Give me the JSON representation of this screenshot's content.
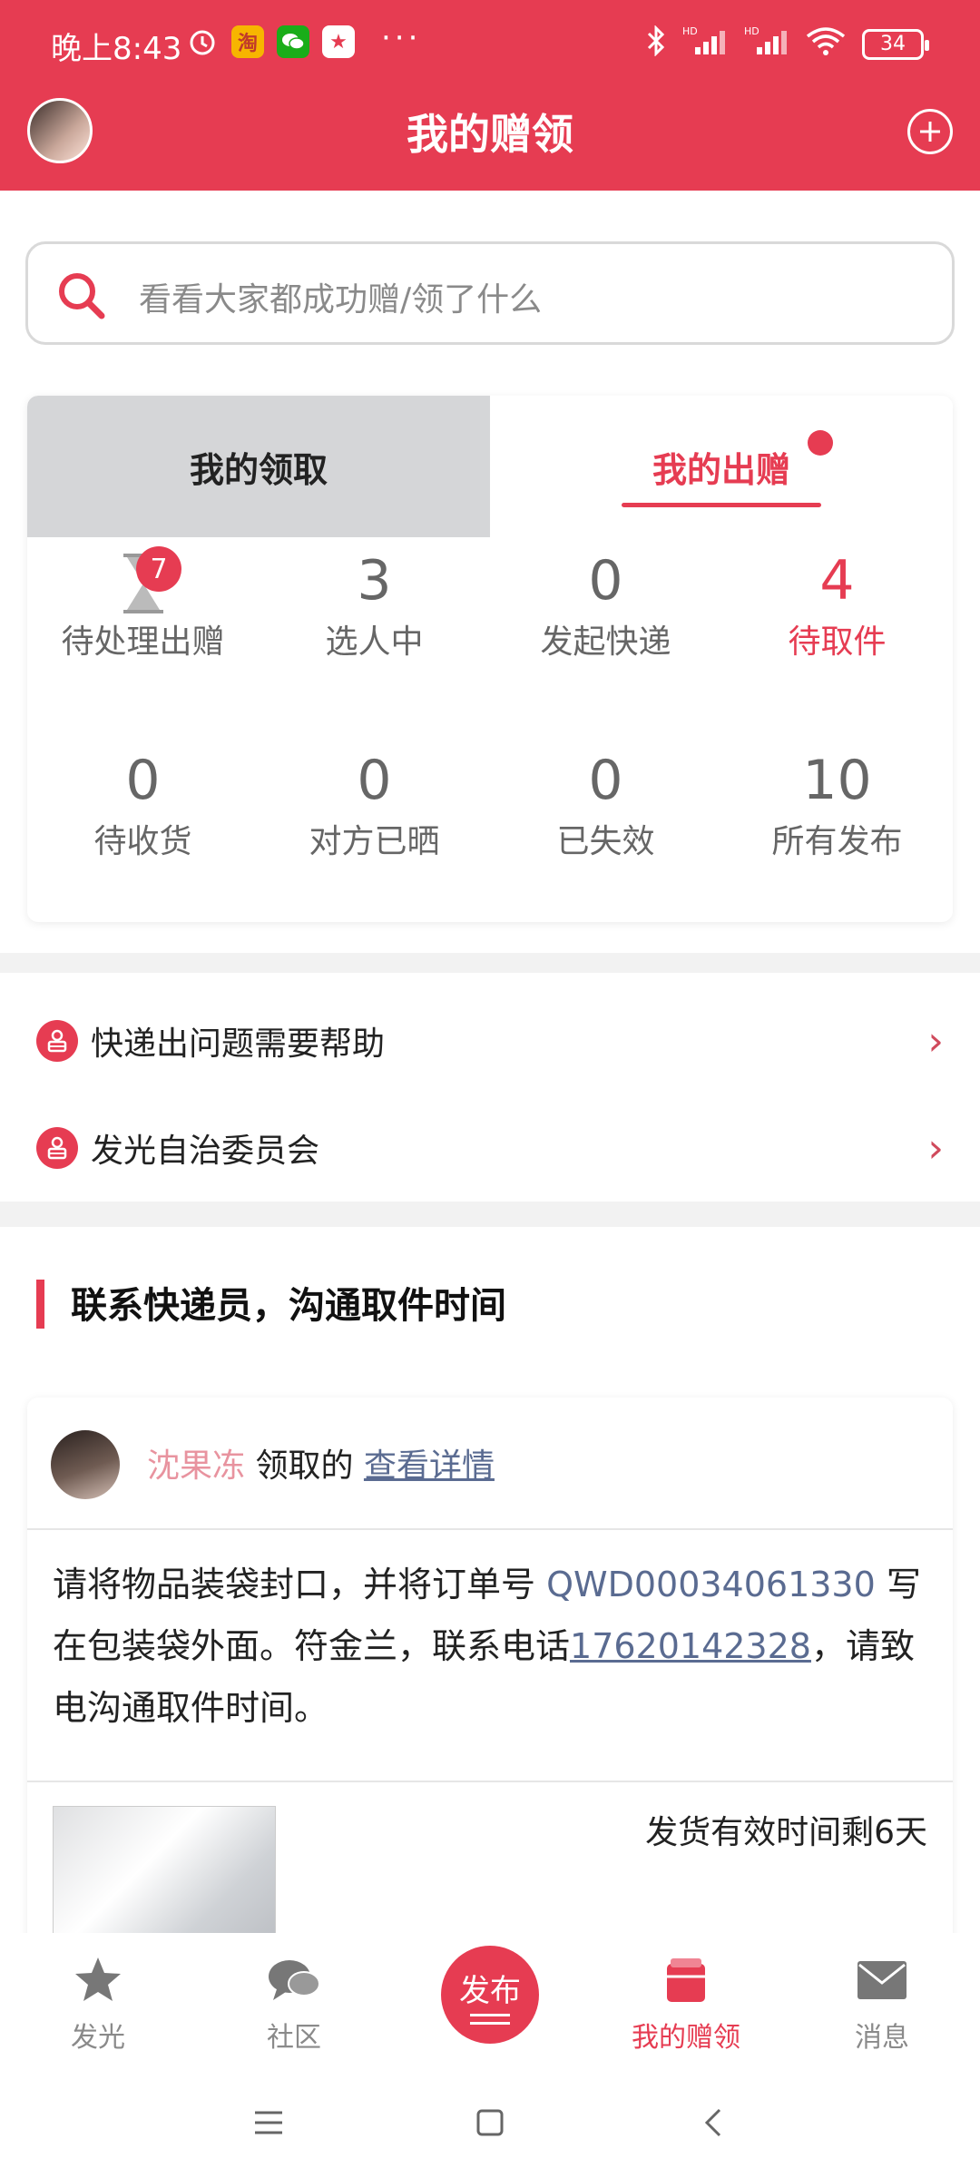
{
  "status_bar": {
    "time": "晚上8:43",
    "dots": "···",
    "battery": "34"
  },
  "header": {
    "title": "我的赠领"
  },
  "search": {
    "placeholder": "看看大家都成功赠/领了什么"
  },
  "tabs": [
    {
      "label": "我的领取",
      "active": false
    },
    {
      "label": "我的出赠",
      "active": true,
      "has_dot": true
    }
  ],
  "stats": [
    {
      "value": "",
      "label": "待处理出赠",
      "badge": "7",
      "icon": "hourglass-icon"
    },
    {
      "value": "3",
      "label": "选人中"
    },
    {
      "value": "0",
      "label": "发起快递"
    },
    {
      "value": "4",
      "label": "待取件",
      "highlight": true
    },
    {
      "value": "0",
      "label": "待收货"
    },
    {
      "value": "0",
      "label": "对方已晒"
    },
    {
      "value": "0",
      "label": "已失效"
    },
    {
      "value": "10",
      "label": "所有发布"
    }
  ],
  "links": [
    {
      "label": "快递出问题需要帮助",
      "icon": "courier-icon"
    },
    {
      "label": "发光自治委员会",
      "icon": "committee-icon"
    }
  ],
  "section": {
    "title": "联系快递员，沟通取件时间"
  },
  "order_card": {
    "receiver_name": "沈果冻",
    "action_text": "领取的",
    "detail_link": "查看详情",
    "body_1": "请将物品装袋封口，并将订单号 ",
    "order_no": "QWD00034061330",
    "body_2": " 写在包装袋外面。符金兰，联系电话",
    "phone": "17620142328",
    "body_3": "，请致电沟通取件时间。",
    "deadline": "发货有效时间剩6天"
  },
  "bottom_nav": [
    {
      "label": "发光",
      "icon": "star-icon",
      "active": false
    },
    {
      "label": "社区",
      "icon": "chat-bubble-icon",
      "active": false
    },
    {
      "label": "发布",
      "icon": "publish-button",
      "active": false
    },
    {
      "label": "我的赠领",
      "icon": "gift-box-icon",
      "active": true
    },
    {
      "label": "消息",
      "icon": "mail-icon",
      "active": false
    }
  ],
  "colors": {
    "primary": "#e63c52",
    "link": "#5a6b91",
    "name": "#e8939f",
    "muted": "#666666"
  }
}
